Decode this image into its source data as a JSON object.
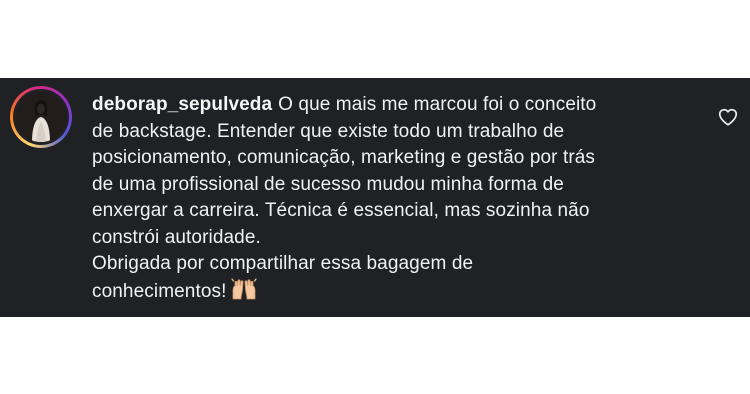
{
  "comment": {
    "username": "deborap_sepulveda",
    "lines": [
      "O que mais me marcou foi o conceito",
      "de backstage. Entender que existe todo um trabalho de",
      "posicionamento, comunicação, marketing e gestão por trás",
      "de uma profissional de sucesso mudou minha forma de",
      "enxergar a carreira. Técnica é essencial, mas sozinha não",
      "constrói autoridade.",
      "Obrigada por compartilhar essa bagagem de",
      "conhecimentos!"
    ],
    "emoji_icon": "raising-hands-emoji",
    "like_icon": "heart-outline-icon"
  },
  "colors": {
    "card_background": "#1f2124",
    "text": "#f1f1f1",
    "story_ring": [
      "#feda75",
      "#fa7e1e",
      "#d62976",
      "#962fbf",
      "#4f5bd5"
    ]
  }
}
